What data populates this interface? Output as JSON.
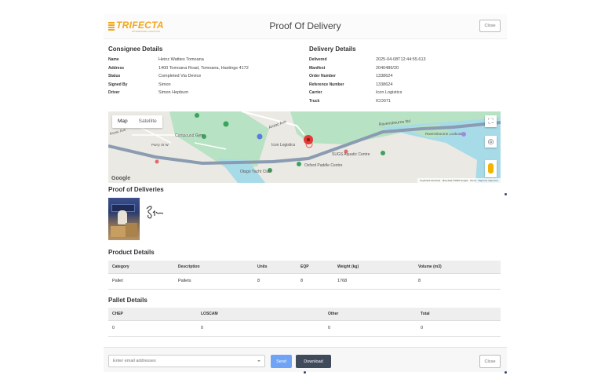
{
  "header": {
    "logo_text": "TRIFECTA",
    "logo_tagline": "INTEGRATED LOGISTICS",
    "title": "Proof Of Delivery",
    "close_label": "Close"
  },
  "consignee": {
    "heading": "Consignee Details",
    "rows": [
      {
        "label": "Name",
        "value": "Heinz Watties Tomoana"
      },
      {
        "label": "Address",
        "value": "1400 Tomoana Road, Tomoana, Hastings 4172"
      },
      {
        "label": "Status",
        "value": "Completed Via Device"
      },
      {
        "label": "Signed By",
        "value": "Simon"
      },
      {
        "label": "Driver",
        "value": "Simon Hepburn"
      }
    ]
  },
  "delivery": {
    "heading": "Delivery Details",
    "rows": [
      {
        "label": "Delivered",
        "value": "2025-04-08T12:44:55.613"
      },
      {
        "label": "Manifest",
        "value": "2040486/20"
      },
      {
        "label": "Order Number",
        "value": "1338624"
      },
      {
        "label": "Reference Number",
        "value": "1338624"
      },
      {
        "label": "Carrier",
        "value": "Icon Logistics"
      },
      {
        "label": "Truck",
        "value": "ICO071"
      }
    ]
  },
  "map": {
    "tab_map": "Map",
    "tab_satellite": "Satellite",
    "labels": {
      "compound": "Compound Gym",
      "icon": "Icon Logistics",
      "sugs": "SUGS Aquatic Centre",
      "paddle": "Oxford Paddle Centre",
      "yacht": "Otago Yacht Club",
      "ravens": "Ravensbourne Lookout",
      "road1": "Anzac Ave",
      "road2": "Ravensbourne Rd",
      "street": "Parry St W",
      "road3": "Anzac Ave"
    },
    "google": "Google",
    "attrib": [
      "Keyboard shortcuts",
      "Map data ©2025 Google",
      "Terms",
      "Report a map error"
    ]
  },
  "pod": {
    "heading": "Proof of Deliveries"
  },
  "product": {
    "heading": "Product Details",
    "columns": [
      "Category",
      "Description",
      "Units",
      "EQP",
      "Weight (kg)",
      "Volume (m3)"
    ],
    "rows": [
      [
        "Pallet",
        "Pallets",
        "8",
        "8",
        "1768",
        "8"
      ]
    ]
  },
  "pallet": {
    "heading": "Pallet Details",
    "columns": [
      "CHEP",
      "LOSCAM",
      "Other",
      "Total"
    ],
    "rows": [
      [
        "0",
        "0",
        "0",
        "0"
      ]
    ]
  },
  "footer": {
    "email_placeholder": "Enter email addresses",
    "send_label": "Send",
    "download_label": "Download",
    "close_label": "Close"
  },
  "colors": {
    "brand": "#f2a71b",
    "send": "#6ea3f5",
    "download": "#3f4a5a",
    "park": "#b7e2c3",
    "water": "#a8dbe8",
    "road": "#8a9bb2",
    "pin": "#e53935"
  }
}
